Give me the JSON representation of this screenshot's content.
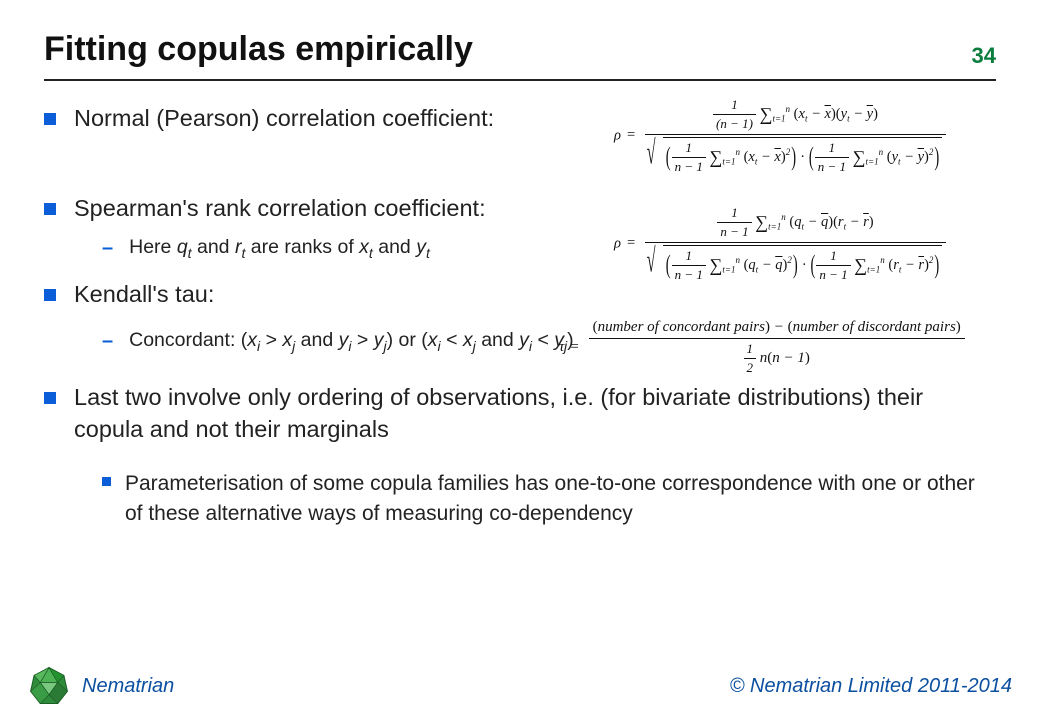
{
  "header": {
    "title": "Fitting copulas empirically",
    "page_number": "34"
  },
  "bullets": {
    "b1": "Normal (Pearson) correlation coefficient:",
    "b2": "Spearman's rank correlation coefficient:",
    "b3": "Kendall's tau:",
    "b4": "Last two involve only ordering of observations, i.e. (for bivariate distributions) their copula and not their marginals",
    "s1_prefix": "Here ",
    "s1_mid1": " and ",
    "s1_mid2": " are ranks of ",
    "s1_mid3": " and ",
    "s2_prefix": "Concordant: (",
    "s2_a": " > ",
    "s2_b": " and ",
    "s2_c": " > ",
    "s2_d": ") or (",
    "s2_e": " < ",
    "s2_f": " and ",
    "s2_g": " < ",
    "s2_h": ")",
    "sub_b1": "Parameterisation of some copula families has one-to-one correspondence with one or other of these alternative ways of measuring co-dependency"
  },
  "vars": {
    "qt": "q",
    "rt": "r",
    "xt": "x",
    "yt": "y",
    "t": "t",
    "i": "i",
    "j": "j"
  },
  "formula3": {
    "tau": "τ",
    "conc": "number of concordant pairs",
    "disc": "number of discordant pairs",
    "half": "1",
    "two": "2",
    "n": "n",
    "nm1": "n − 1"
  },
  "footer": {
    "brand": "Nematrian",
    "copyright": "© Nematrian Limited 2011-2014"
  }
}
